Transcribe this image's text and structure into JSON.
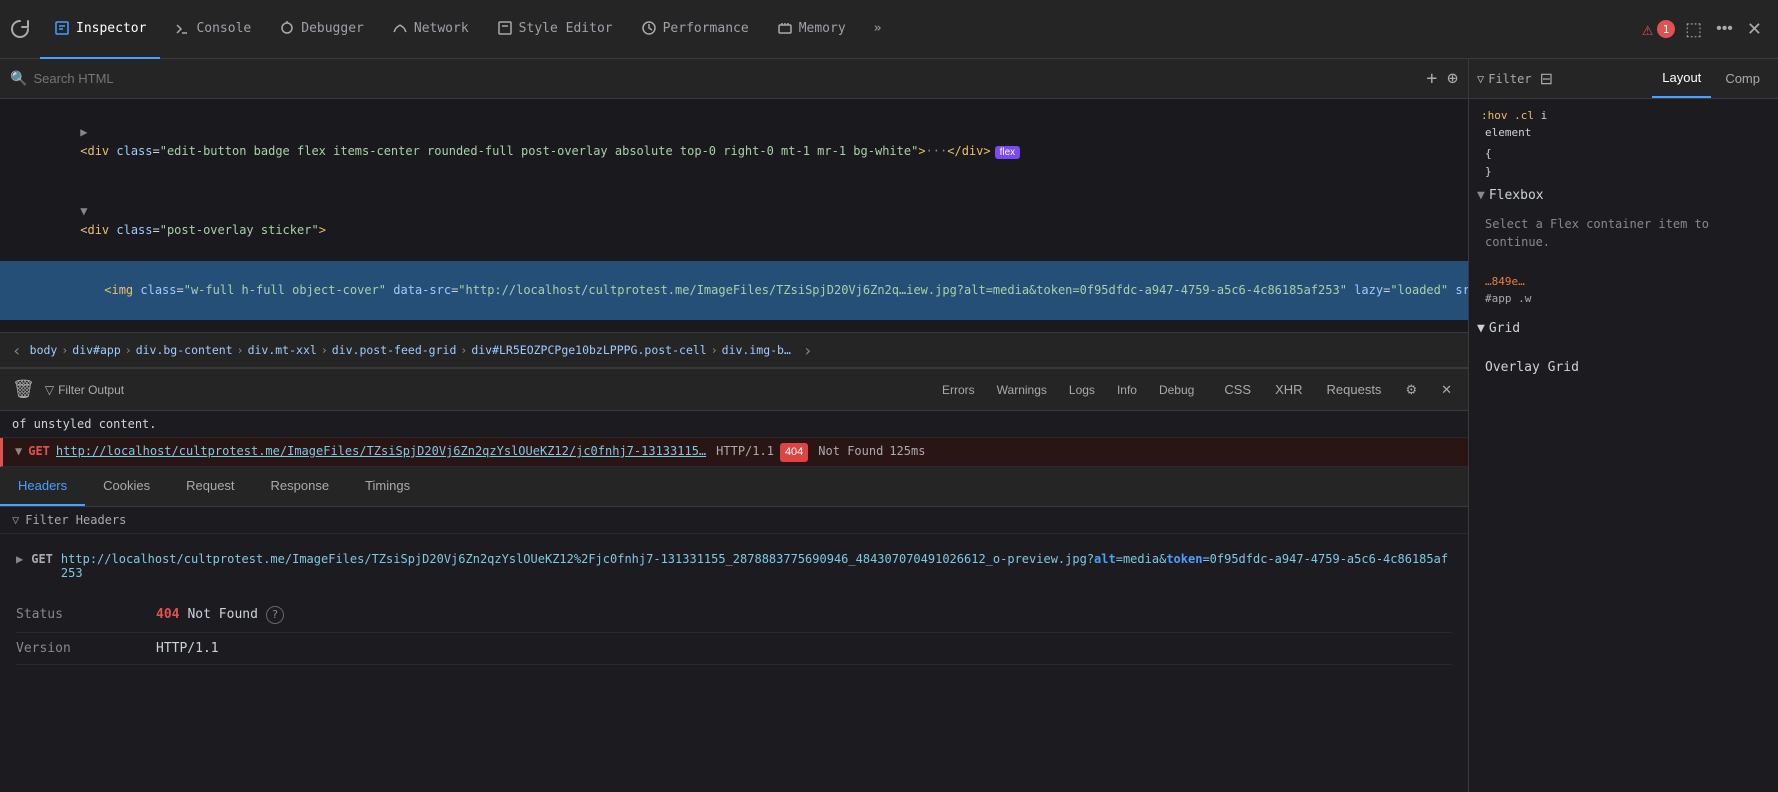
{
  "toolbar": {
    "tabs": [
      {
        "id": "inspector",
        "label": "Inspector",
        "active": true,
        "icon": "inspector-icon"
      },
      {
        "id": "console",
        "label": "Console",
        "active": false,
        "icon": "console-icon"
      },
      {
        "id": "debugger",
        "label": "Debugger",
        "active": false,
        "icon": "debugger-icon"
      },
      {
        "id": "network",
        "label": "Network",
        "active": false,
        "icon": "network-icon"
      },
      {
        "id": "style-editor",
        "label": "Style Editor",
        "active": false,
        "icon": "style-icon"
      },
      {
        "id": "performance",
        "label": "Performance",
        "active": false,
        "icon": "perf-icon"
      },
      {
        "id": "memory",
        "label": "Memory",
        "active": false,
        "icon": "memory-icon"
      }
    ],
    "more_btn": "»",
    "error_count": "1",
    "close": "✕"
  },
  "inspector": {
    "search_placeholder": "Search HTML",
    "html_lines": [
      {
        "id": 1,
        "text_raw": "<div class=\"edit-button badge flex items-center rounded-full post-overlay absolute top-0 right-0 mt-1 mr-1 bg-white\">···</div>",
        "selected": false,
        "has_flex_badge": true
      },
      {
        "id": 2,
        "text_raw": "<div class=\"post-overlay sticker\">",
        "selected": false
      },
      {
        "id": 3,
        "text_raw": "<img class=\"w-full h-full object-cover\" data-src=\"http://localhost/cultprotest.me/ImageFiles/TZsiSpjD20Vj6Zn2q…iew.jpg?alt=media&token=0f95dfdc-a947-4759-a5c6-4c86185af253\" lazy=\"loaded\" src=\"http://localhost/cultprotest.me/ImageFiles/TZsiSpjD20Vj6Zn2q…iew.jpg?alt=media&token=0f95dfdc-a947-4759-a5c6-4c86185af253\">",
        "selected": true
      }
    ],
    "breadcrumb": {
      "nav_back": "‹",
      "nav_forward": "›",
      "items": [
        "body",
        "div#app",
        "div.bg-content",
        "div.mt-xxl",
        "div.post-feed-grid",
        "div#LR5EOZPCPge10bzLPPPG.post-cell",
        "div.img-b…"
      ]
    }
  },
  "right_panel": {
    "filter_label": "Filter",
    "tabs": [
      {
        "id": "layout",
        "label": "Layout",
        "active": true
      },
      {
        "id": "comp",
        "label": "Comp",
        "active": false
      }
    ],
    "flexbox_section": {
      "label": "Flexbox",
      "hint_hov": ":hov .cl",
      "hint_i": "i",
      "hint_element": "element",
      "code_lines": [
        "{",
        "}"
      ],
      "select_hint": "Select a Flex container item to continue.",
      "side_val1": "…849e…",
      "side_app": "#app .w"
    },
    "grid_section": {
      "label": "Grid"
    },
    "overlay_grid_label": "Overlay Grid"
  },
  "console": {
    "filter_output_label": "Filter Output",
    "log_filters": [
      "Errors",
      "Warnings",
      "Logs",
      "Info",
      "Debug"
    ],
    "active_filter": "none",
    "right_btns": [
      "CSS",
      "XHR",
      "Requests"
    ],
    "info_line": "of unstyled content."
  },
  "network_request": {
    "method": "GET",
    "url_truncated": "http://localhost/cultprotest.me/ImageFiles/TZsiSpjD20Vj6Zn2qzYslOUeKZ12/jc0fnhj7-13133115…",
    "protocol": "HTTP/1.1",
    "status_code": "404",
    "status_text": "Not Found",
    "timing": "125ms",
    "tabs": [
      {
        "id": "headers",
        "label": "Headers",
        "active": true
      },
      {
        "id": "cookies",
        "label": "Cookies"
      },
      {
        "id": "request",
        "label": "Request"
      },
      {
        "id": "response",
        "label": "Response"
      },
      {
        "id": "timings",
        "label": "Timings"
      }
    ],
    "filter_headers_placeholder": "Filter Headers",
    "request_url_full": "http://localhost/cultprotest.me/ImageFiles/TZsiSpjD20Vj6Zn2qzYslOUeKZ12%2Fjc0fnhj7-131331155_2878883775690946_4843070704910266l2_o-preview.jpg?",
    "request_url_alt": "alt=media",
    "request_url_token": "token=0f95dfdc-a947-4759-a5c6-4c86185af253",
    "status_label": "Status",
    "status_value_code": "404",
    "status_value_text": "Not Found",
    "version_label": "Version",
    "version_value": "HTTP/1.1"
  }
}
